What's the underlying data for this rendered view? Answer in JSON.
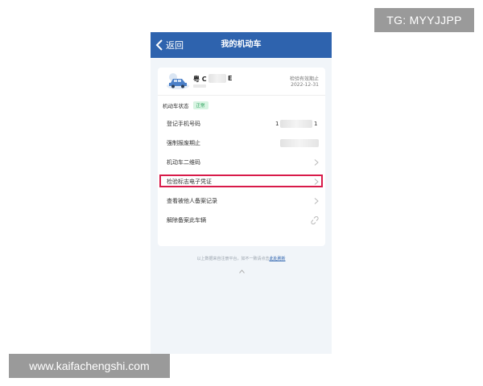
{
  "watermarks": {
    "top_right": "TG: MYYJJPP",
    "bottom_left": "www.kaifachengshi.com"
  },
  "nav": {
    "back_label": "返回",
    "title": "我的机动车"
  },
  "vehicle": {
    "plate_prefix": "粤 C",
    "plate_suffix": "E",
    "valid_label": "检验有效期止",
    "valid_date": "2022-12-31",
    "status_label": "机动车状态",
    "status_badge": "正常"
  },
  "rows": {
    "phone_label": "登记手机号码",
    "phone_prefix": "1",
    "phone_suffix": "1",
    "scrap_label": "强制报废期止",
    "qr_label": "机动车二维码",
    "inspection_label": "检验标志电子凭证",
    "records_label": "查看被他人备案记录",
    "unbind_label": "解除备案此车辆"
  },
  "footer": {
    "note": "以上数据来自注册平台，如不一致请点击",
    "refresh_link": "此处刷新"
  },
  "colors": {
    "nav_bg": "#2e63ae",
    "highlight": "#d81b4a",
    "badge_bg": "#d8f4e2",
    "badge_text": "#2aa05a"
  }
}
